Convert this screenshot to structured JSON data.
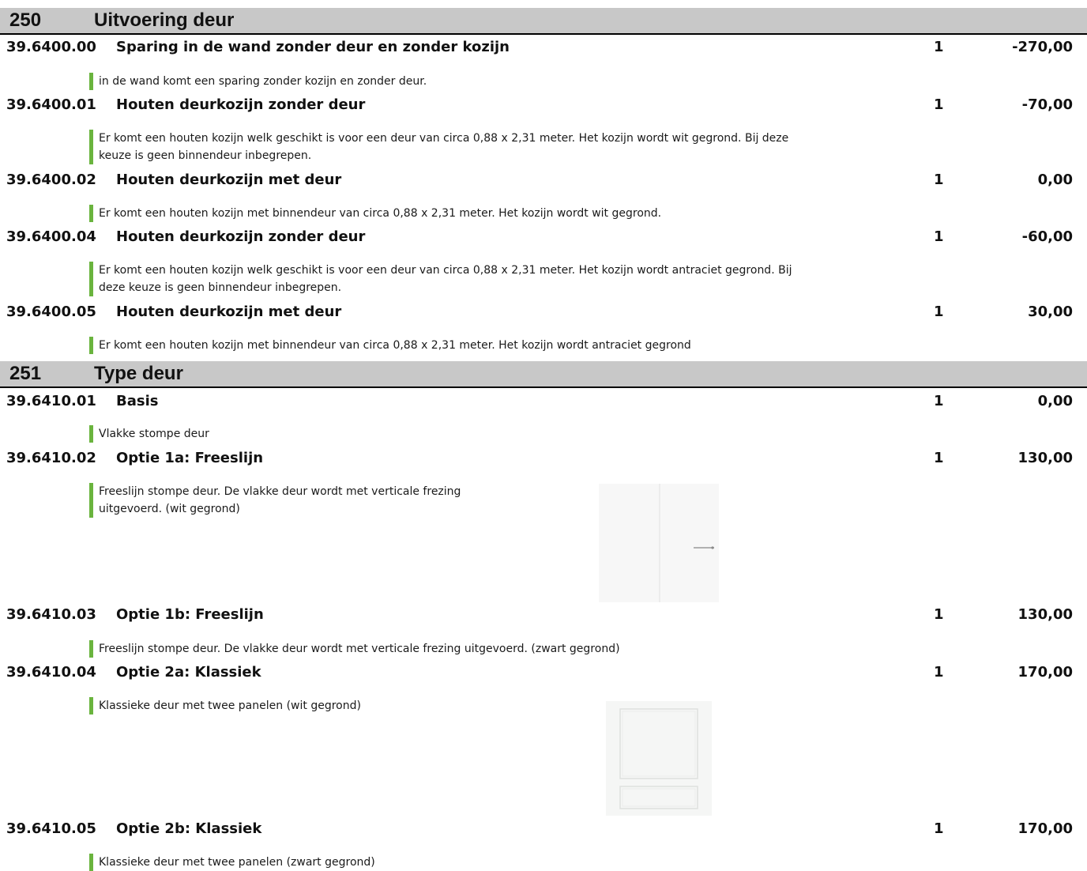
{
  "sections": [
    {
      "number": "250",
      "title": "Uitvoering deur",
      "items": [
        {
          "code": "39.6400.00",
          "name": "Sparing in de wand zonder deur en zonder kozijn",
          "qty": "1",
          "price": "-270,00",
          "description": "in de wand komt een sparing zonder kozijn en zonder deur."
        },
        {
          "code": "39.6400.01",
          "name": "Houten deurkozijn zonder deur",
          "qty": "1",
          "price": "-70,00",
          "description_lines": [
            "Er komt een houten kozijn welk geschikt is voor een deur van circa 0,88 x 2,31 meter. Het kozijn wordt wit gegrond. Bij deze",
            "keuze is geen binnendeur inbegrepen."
          ]
        },
        {
          "code": "39.6400.02",
          "name": "Houten deurkozijn met deur",
          "qty": "1",
          "price": "0,00",
          "description": "Er komt een houten kozijn met binnendeur van circa 0,88 x 2,31 meter. Het kozijn wordt wit gegrond."
        },
        {
          "code": "39.6400.04",
          "name": "Houten deurkozijn zonder deur",
          "qty": "1",
          "price": "-60,00",
          "description_lines": [
            "Er komt een houten kozijn welk geschikt is voor een deur van circa 0,88 x 2,31 meter. Het kozijn wordt antraciet gegrond. Bij",
            "deze keuze is geen binnendeur inbegrepen."
          ]
        },
        {
          "code": "39.6400.05",
          "name": "Houten deurkozijn met deur",
          "qty": "1",
          "price": "30,00",
          "description": "Er komt een houten kozijn met binnendeur van circa 0,88 x 2,31 meter. Het kozijn wordt antraciet gegrond"
        }
      ]
    },
    {
      "number": "251",
      "title": "Type deur",
      "items": [
        {
          "code": "39.6410.01",
          "name": "Basis",
          "qty": "1",
          "price": "0,00",
          "description": "Vlakke stompe deur"
        },
        {
          "code": "39.6410.02",
          "name": "Optie 1a: Freeslijn",
          "qty": "1",
          "price": "130,00",
          "description_lines": [
            "Freeslijn stompe deur. De vlakke deur wordt met verticale frezing",
            "uitgevoerd. (wit gegrond)"
          ]
        },
        {
          "code": "39.6410.03",
          "name": "Optie 1b: Freeslijn",
          "qty": "1",
          "price": "130,00",
          "description": "Freeslijn stompe deur. De vlakke deur wordt met verticale frezing uitgevoerd. (zwart gegrond)"
        },
        {
          "code": "39.6410.04",
          "name": "Optie 2a: Klassiek",
          "qty": "1",
          "price": "170,00",
          "description": "Klassieke deur met twee panelen (wit gegrond)"
        },
        {
          "code": "39.6410.05",
          "name": "Optie 2b: Klassiek",
          "qty": "1",
          "price": "170,00",
          "description": "Klassieke deur met twee panelen (zwart gegrond)"
        }
      ]
    }
  ],
  "colors": {
    "header_bg": "#c8c8c8",
    "accent_bar": "#6ab43e"
  }
}
